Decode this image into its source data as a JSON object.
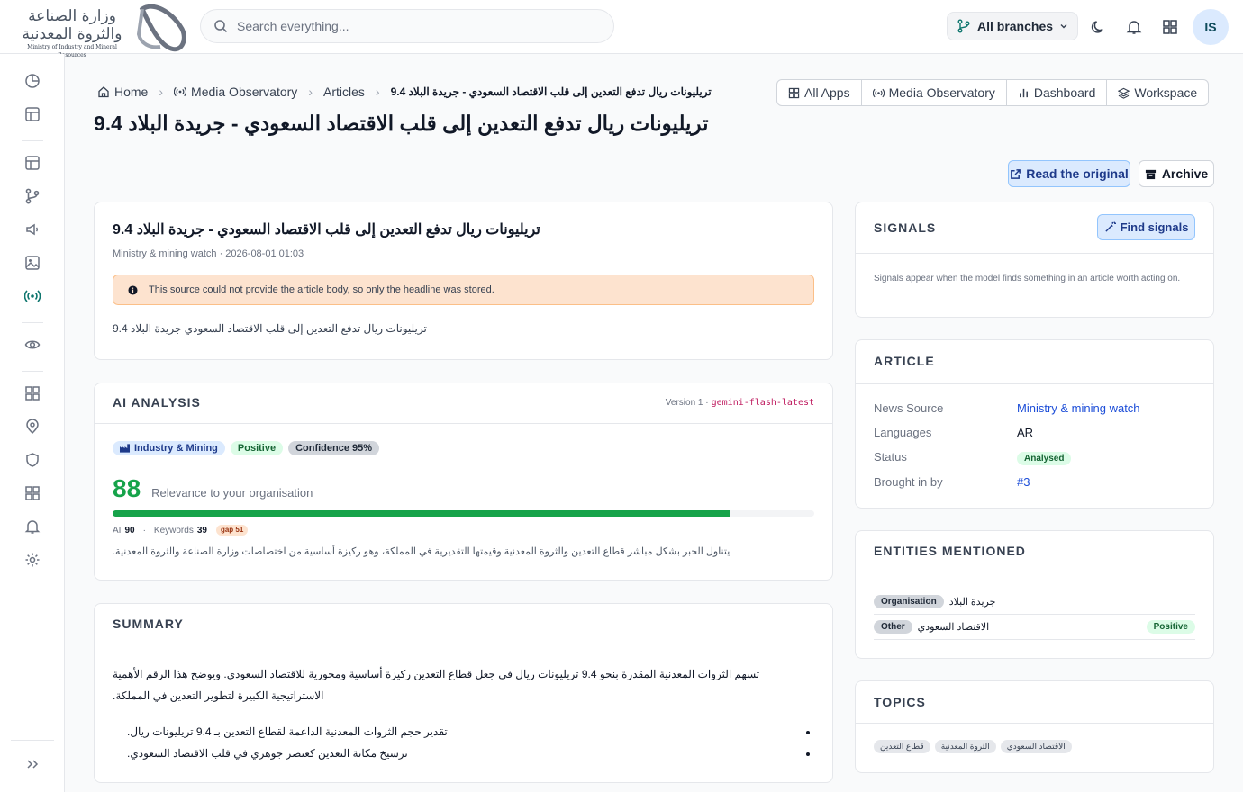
{
  "header": {
    "logo": {
      "line1": "وزارة الصناعة",
      "line2": "والثروة المعدنية",
      "english": "Ministry of Industry and Mineral Resources"
    },
    "search_placeholder": "Search everything...",
    "branch_label": "All branches",
    "avatar_initials": "IS",
    "icons": [
      "search-icon",
      "branch-icon",
      "chevron-down-icon",
      "moon-icon",
      "bell-icon",
      "grid-icon"
    ]
  },
  "sidebar": {
    "icons": [
      "chart-pie-icon",
      "layout-icon",
      "layout-icon",
      "branch-icon",
      "megaphone-icon",
      "image-icon",
      "radio-broadcast-icon",
      "eye-icon",
      "grid-icon",
      "map-pin-icon",
      "shield-icon",
      "grid-icon",
      "bell-icon",
      "settings-icon",
      "expand-icon"
    ],
    "active": "radio-broadcast-icon"
  },
  "breadcrumb": {
    "items": [
      "Home",
      "Media Observatory",
      "Articles"
    ],
    "current": "تريليونات ريال تدفع التعدين إلى قلب الاقتصاد السعودي - جريدة البلاد 9.4"
  },
  "app_nav": [
    "All Apps",
    "Media Observatory",
    "Dashboard",
    "Workspace"
  ],
  "page_title": "تريليونات ريال تدفع التعدين إلى قلب الاقتصاد السعودي - جريدة البلاد 9.4",
  "actions": {
    "read_original": "Read the original",
    "archive": "Archive"
  },
  "article_card": {
    "headline": "تريليونات ريال تدفع التعدين إلى قلب الاقتصاد السعودي - جريدة البلاد 9.4",
    "meta": "Ministry & mining watch · 2026-08-01 01:03",
    "warning": "This source could not provide the article body, so only the headline was stored.",
    "body": "تريليونات ريال تدفع التعدين إلى قلب الاقتصاد السعودي جريدة البلاد 9.4"
  },
  "ai_analysis": {
    "title": "AI ANALYSIS",
    "version_prefix": "Version 1 ·",
    "model": "gemini-flash-latest",
    "category": "Industry & Mining",
    "sentiment": "Positive",
    "confidence": "Confidence 95%",
    "score": "88",
    "score_label": "Relevance to your organisation",
    "score_fraction": 0.88,
    "ai_label": "AI",
    "ai_value": "90",
    "sep": "·",
    "keywords_label": "Keywords",
    "keywords_value": "39",
    "gap": "gap 51",
    "rationale": "يتناول الخبر بشكل مباشر قطاع التعدين والثروة المعدنية وقيمتها التقديرية في المملكة، وهو ركيزة أساسية من اختصاصات وزارة الصناعة والثروة المعدنية."
  },
  "summary": {
    "title": "SUMMARY",
    "paragraph": "تسهم الثروات المعدنية المقدرة بنحو 9.4 تريليونات ريال في جعل قطاع التعدين ركيزة أساسية ومحورية للاقتصاد السعودي. ويوضح هذا الرقم الأهمية الاستراتيجية الكبيرة لتطوير التعدين في المملكة.",
    "bullets": [
      "تقدير حجم الثروات المعدنية الداعمة لقطاع التعدين بـ 9.4 تريليونات ريال.",
      "ترسيخ مكانة التعدين كعنصر جوهري في قلب الاقتصاد السعودي."
    ]
  },
  "signals": {
    "title": "SIGNALS",
    "button": "Find signals",
    "empty_text": "Signals appear when the model finds something in an article worth acting on."
  },
  "article_info": {
    "title": "ARTICLE",
    "rows": [
      {
        "key": "News Source",
        "value": "Ministry & mining watch"
      },
      {
        "key": "Languages",
        "value": "AR"
      },
      {
        "key": "Status",
        "value": "Analysed"
      },
      {
        "key": "Brought in by",
        "value": "#3"
      }
    ]
  },
  "entities": {
    "title": "ENTITIES MENTIONED",
    "items": [
      {
        "type": "Organisation",
        "name": "جريدة البلاد",
        "sentiment": ""
      },
      {
        "type": "Other",
        "name": "الاقتصاد السعودي",
        "sentiment": "Positive"
      }
    ]
  },
  "topics": {
    "title": "TOPICS",
    "items": [
      "قطاع التعدين",
      "الثروة المعدنية",
      "الاقتصاد السعودي"
    ]
  },
  "colors": {
    "accent": "#0f766e",
    "positive": "#16a34a",
    "warning_bg": "#fde3cf",
    "link": "#1d4ed8"
  }
}
